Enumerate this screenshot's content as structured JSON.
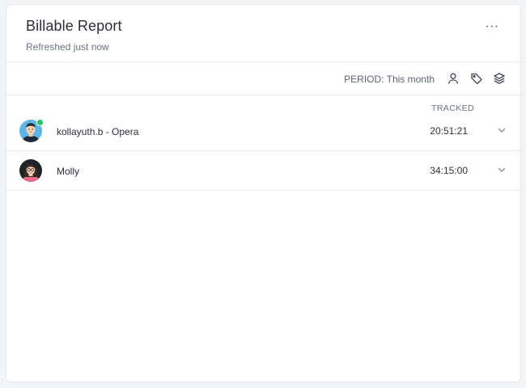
{
  "report": {
    "title": "Billable Report",
    "subtitle": "Refreshed just now",
    "more_icon": "more-horizontal-icon",
    "more_label": "···"
  },
  "toolbar": {
    "period_label": "PERIOD: This month",
    "icons": [
      "user-icon",
      "tag-icon",
      "layers-icon"
    ]
  },
  "table": {
    "column_header": "TRACKED",
    "rows": [
      {
        "name": "kollayuth.b - Opera",
        "tracked": "20:51:21",
        "online": true,
        "avatar": "avatar-man-icon"
      },
      {
        "name": "Molly",
        "tracked": "34:15:00",
        "online": false,
        "avatar": "avatar-woman-icon"
      }
    ]
  },
  "colors": {
    "accent_online": "#22c55e",
    "text_primary": "#2d3138",
    "text_muted": "#6b7280",
    "border": "#e8e9ec"
  }
}
